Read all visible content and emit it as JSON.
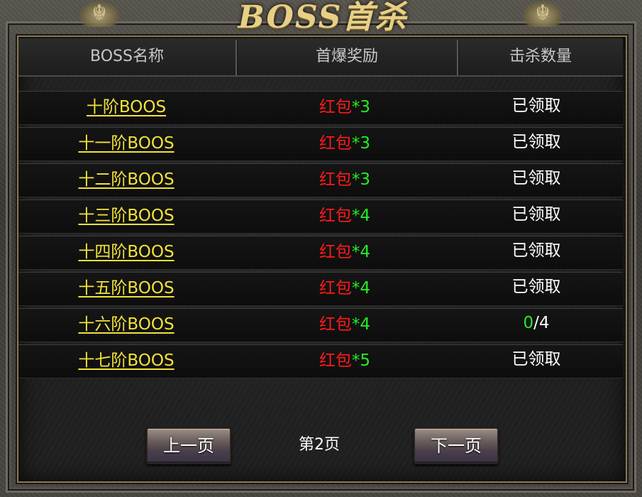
{
  "window": {
    "title": "BOSS首杀"
  },
  "table": {
    "headers": {
      "name": "BOSS名称",
      "reward": "首爆奖励",
      "kills": "击杀数量"
    },
    "rows": [
      {
        "name": "十阶BOOS",
        "reward_item": "红包",
        "reward_mult": "*3",
        "status": "已领取"
      },
      {
        "name": "十一阶BOOS",
        "reward_item": "红包",
        "reward_mult": "*3",
        "status": "已领取"
      },
      {
        "name": "十二阶BOOS",
        "reward_item": "红包",
        "reward_mult": "*3",
        "status": "已领取"
      },
      {
        "name": "十三阶BOOS",
        "reward_item": "红包",
        "reward_mult": "*4",
        "status": "已领取"
      },
      {
        "name": "十四阶BOOS",
        "reward_item": "红包",
        "reward_mult": "*4",
        "status": "已领取"
      },
      {
        "name": "十五阶BOOS",
        "reward_item": "红包",
        "reward_mult": "*4",
        "status": "已领取"
      },
      {
        "name": "十六阶BOOS",
        "reward_item": "红包",
        "reward_mult": "*4",
        "kill_current": "0",
        "kill_total": "/4"
      },
      {
        "name": "十七阶BOOS",
        "reward_item": "红包",
        "reward_mult": "*5",
        "status": "已领取"
      }
    ]
  },
  "pagination": {
    "prev_label": "上一页",
    "next_label": "下一页",
    "page_label": "第2页"
  },
  "colors": {
    "boss_name": "#f2e23a",
    "reward_item": "#ff1a1a",
    "reward_mult": "#22ee22",
    "claimed_text": "#ffffff",
    "kill_progress": "#22ee22"
  }
}
